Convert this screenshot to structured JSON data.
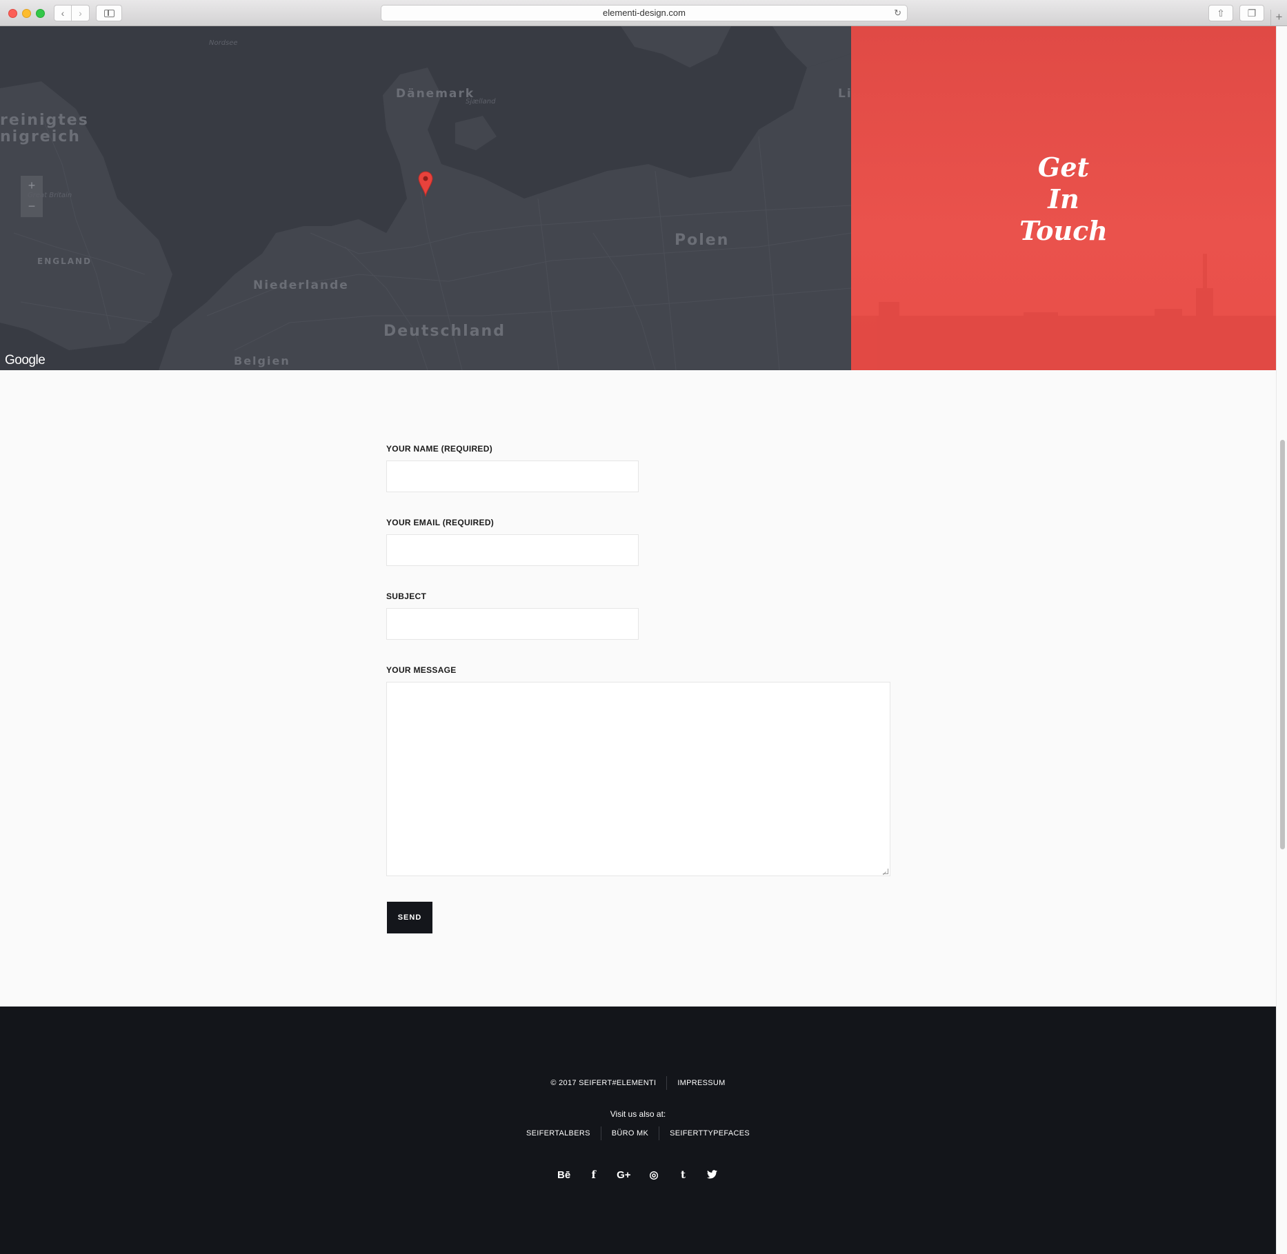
{
  "browser": {
    "url": "elementi-design.com",
    "back_icon": "‹",
    "forward_icon": "›",
    "reload_icon": "↻",
    "share_icon": "⇧",
    "tabs_icon": "❐",
    "new_tab_icon": "+"
  },
  "map": {
    "labels": {
      "nordsee": "Nordsee",
      "daenemark": "Dänemark",
      "sjaelland": "Sjælland",
      "vereinigtes_1": "reinigtes",
      "vereinigtes_2": "nigreich",
      "great_britain": "Great Britain",
      "england": "ENGLAND",
      "niederlande": "Niederlande",
      "deutschland": "Deutschland",
      "belgien": "Belgien",
      "polen": "Polen",
      "li": "Li"
    },
    "zoom_in": "+",
    "zoom_out": "−",
    "provider": "Google",
    "marker_color": "#e8423c"
  },
  "hero": {
    "tagline_line1": "Get",
    "tagline_line2": "In",
    "tagline_line3": "Touch",
    "accent_color": "#ea524c"
  },
  "form": {
    "name_label": "YOUR NAME (REQUIRED)",
    "name_value": "",
    "email_label": "YOUR EMAIL (REQUIRED)",
    "email_value": "",
    "subject_label": "SUBJECT",
    "subject_value": "",
    "message_label": "YOUR MESSAGE",
    "message_value": "",
    "send_label": "SEND"
  },
  "footer": {
    "copyright": "© 2017 SEIFERT#ELEMENTI",
    "impressum": "IMPRESSUM",
    "visit_text": "Visit us also at:",
    "links": [
      "SEIFERTALBERS",
      "BÜRO MK",
      "SEIFERTTYPEFACES"
    ],
    "social": {
      "behance": "Bē",
      "facebook": "f",
      "google_plus": "G+",
      "instagram": "◎",
      "tumblr": "t",
      "twitter": "🐦"
    }
  }
}
